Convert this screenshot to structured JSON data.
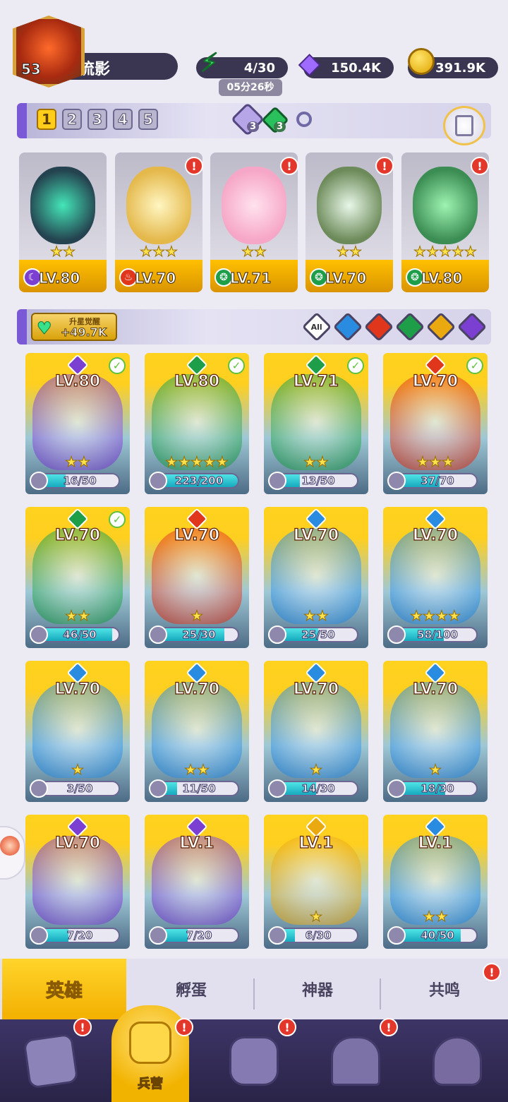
{
  "player": {
    "level": "53",
    "name": "流影"
  },
  "resources": {
    "energy": {
      "value": "4/30",
      "timer": "05分26秒"
    },
    "gems": {
      "value": "150.4K"
    },
    "gold": {
      "value": "391.9K"
    }
  },
  "lineup": {
    "slots": [
      "1",
      "2",
      "3",
      "4",
      "5"
    ],
    "active_slot": 0,
    "counters": [
      {
        "icon": "purple-crystal-icon",
        "count": "3"
      },
      {
        "icon": "green-crystal-icon",
        "count": "3"
      }
    ],
    "heroes": [
      {
        "level": "LV.80",
        "element": "dark",
        "stars": "★★",
        "alert": false
      },
      {
        "level": "LV.70",
        "element": "fire",
        "stars": "★★★",
        "alert": true
      },
      {
        "level": "LV.71",
        "element": "nature",
        "stars": "★★",
        "alert": true
      },
      {
        "level": "LV.70",
        "element": "nature",
        "stars": "★★",
        "alert": true
      },
      {
        "level": "LV.80",
        "element": "nature",
        "stars": "★★★★★",
        "alert": true
      }
    ]
  },
  "awaken": {
    "label": "升星觉醒",
    "value": "+49.7K"
  },
  "filters": {
    "all_label": "All",
    "elements": [
      "water",
      "fire",
      "nature",
      "light",
      "dark"
    ]
  },
  "colors": {
    "dark": "#7b3fd1",
    "fire": "#e0361b",
    "nature": "#1f9e4a",
    "water": "#2a8ce0",
    "light": "#e9a90f",
    "accent": "#ffcc1a"
  },
  "roster": [
    {
      "level": "LV.80",
      "element": "dark",
      "check": true,
      "stars": "★★",
      "progress": "16/50",
      "fill": 0.32
    },
    {
      "level": "LV.80",
      "element": "nature",
      "check": true,
      "stars": "★★★★★",
      "progress": "223/200",
      "fill": 1.0
    },
    {
      "level": "LV.71",
      "element": "nature",
      "check": true,
      "stars": "★★",
      "progress": "13/50",
      "fill": 0.26
    },
    {
      "level": "LV.70",
      "element": "fire",
      "check": true,
      "stars": "★★★",
      "progress": "37/70",
      "fill": 0.53
    },
    {
      "level": "LV.70",
      "element": "nature",
      "check": true,
      "stars": "★★",
      "progress": "46/50",
      "fill": 0.92
    },
    {
      "level": "LV.70",
      "element": "fire",
      "check": false,
      "stars": "★",
      "progress": "25/30",
      "fill": 0.83
    },
    {
      "level": "LV.70",
      "element": "water",
      "check": false,
      "stars": "★★",
      "progress": "25/50",
      "fill": 0.5
    },
    {
      "level": "LV.70",
      "element": "water",
      "check": false,
      "stars": "★★★★",
      "progress": "58/100",
      "fill": 0.58
    },
    {
      "level": "LV.70",
      "element": "water",
      "check": false,
      "stars": "★",
      "progress": "3/50",
      "fill": 0.06
    },
    {
      "level": "LV.70",
      "element": "water",
      "check": false,
      "stars": "★★",
      "progress": "11/50",
      "fill": 0.22
    },
    {
      "level": "LV.70",
      "element": "water",
      "check": false,
      "stars": "★",
      "progress": "14/30",
      "fill": 0.47
    },
    {
      "level": "LV.70",
      "element": "water",
      "check": false,
      "stars": "★",
      "progress": "18/30",
      "fill": 0.6
    },
    {
      "level": "LV.70",
      "element": "dark",
      "check": false,
      "stars": "",
      "progress": "7/20",
      "fill": 0.35
    },
    {
      "level": "LV.1",
      "element": "dark",
      "check": false,
      "stars": "",
      "progress": "7/20",
      "fill": 0.35
    },
    {
      "level": "LV.1",
      "element": "light",
      "check": false,
      "stars": "★",
      "progress": "6/30",
      "fill": 0.2
    },
    {
      "level": "LV.1",
      "element": "water",
      "check": false,
      "stars": "★★",
      "progress": "40/50",
      "fill": 0.8
    }
  ],
  "tabs": [
    {
      "label": "英雄",
      "active": true,
      "alert": false
    },
    {
      "label": "孵蛋",
      "active": false,
      "alert": false
    },
    {
      "label": "神器",
      "active": false,
      "alert": false
    },
    {
      "label": "共鸣",
      "active": false,
      "alert": true
    }
  ],
  "nav": [
    {
      "name": "cards",
      "label": "",
      "alert": true,
      "icon": "cards-icon"
    },
    {
      "name": "barracks",
      "label": "兵营",
      "alert": true,
      "icon": "barracks-icon",
      "active": true
    },
    {
      "name": "book",
      "label": "",
      "alert": true,
      "icon": "book-icon"
    },
    {
      "name": "castle",
      "label": "",
      "alert": true,
      "icon": "castle-icon"
    },
    {
      "name": "mushroom",
      "label": "",
      "alert": false,
      "icon": "mushroom-icon"
    }
  ]
}
